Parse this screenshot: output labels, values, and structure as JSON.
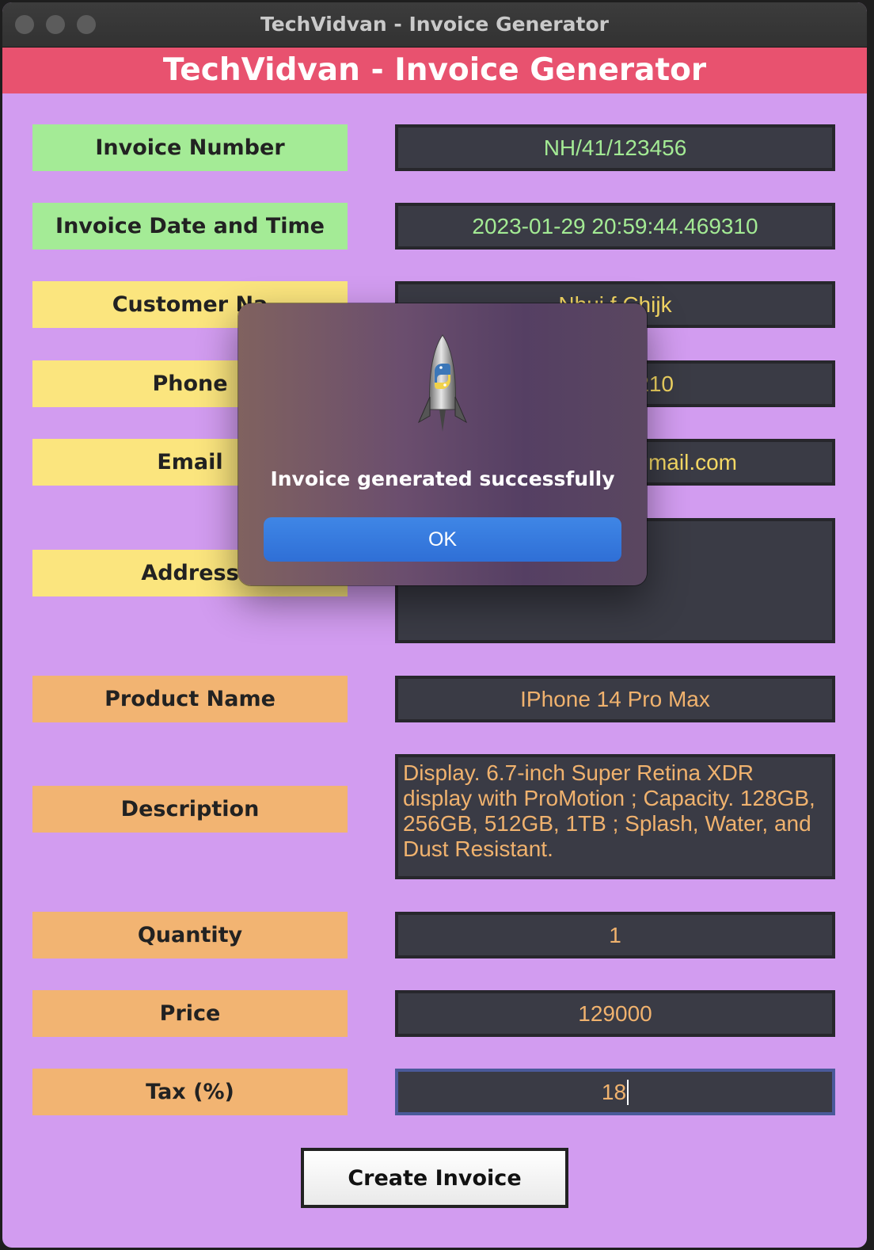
{
  "window": {
    "title": "TechVidvan - Invoice Generator"
  },
  "banner": {
    "title": "TechVidvan - Invoice Generator"
  },
  "form": {
    "invoice_number": {
      "label": "Invoice Number",
      "value": "NH/41/123456"
    },
    "invoice_datetime": {
      "label": "Invoice Date and Time",
      "value": "2023-01-29 20:59:44.469310"
    },
    "customer_name": {
      "label": "Customer Na",
      "value": "Nhuj   f Chijk"
    },
    "phone": {
      "label": "Phone",
      "value": "210"
    },
    "email": {
      "label": "Email",
      "value": "gmail.com"
    },
    "address": {
      "label": "Address",
      "value": ""
    },
    "product_name": {
      "label": "Product Name",
      "value": "IPhone 14 Pro Max"
    },
    "description": {
      "label": "Description",
      "value": "Display. 6.7-inch Super Retina XDR display with ProMotion ; Capacity. 128GB, 256GB, 512GB, 1TB ; Splash, Water, and Dust Resistant."
    },
    "quantity": {
      "label": "Quantity",
      "value": "1"
    },
    "price": {
      "label": "Price",
      "value": "129000"
    },
    "tax": {
      "label": "Tax (%)",
      "value": "18"
    }
  },
  "create_button": {
    "label": "Create Invoice"
  },
  "alert": {
    "icon": "python-rocket-icon",
    "message": "Invoice generated successfully",
    "ok_label": "OK"
  },
  "colors": {
    "banner": "#e8526f",
    "background": "#d29cf0",
    "green_label": "#a4eb96",
    "yellow_label": "#fbe57e",
    "orange_label": "#f2b472",
    "field_bg": "#3a3b45",
    "ok_button": "#3478e0"
  }
}
